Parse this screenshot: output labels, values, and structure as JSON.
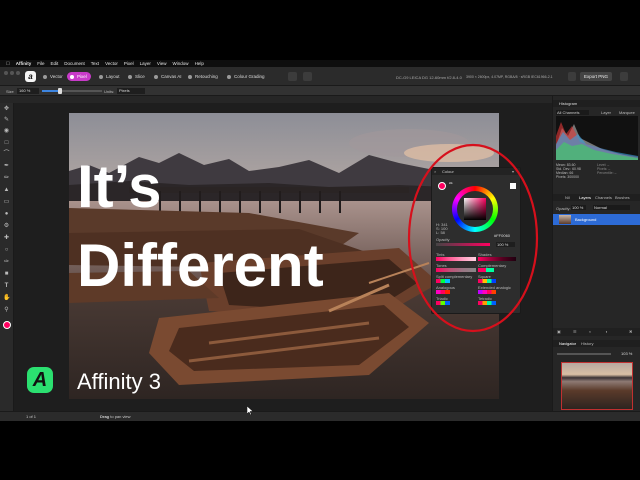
{
  "menubar": {
    "apple": "",
    "items": [
      "Affinity",
      "File",
      "Edit",
      "Document",
      "Text",
      "Vector",
      "Pixel",
      "Layer",
      "View",
      "Window",
      "Help"
    ]
  },
  "toolbar": {
    "personas": [
      {
        "label": "Vector",
        "active": false
      },
      {
        "label": "Pixel",
        "active": true
      },
      {
        "label": "Layout",
        "active": false
      },
      {
        "label": "Slice",
        "active": false
      },
      {
        "label": "Canvas AI",
        "active": false
      },
      {
        "label": "Retouching",
        "active": false
      },
      {
        "label": "Colour Grading",
        "active": false
      }
    ],
    "metadata": "DC-G9 LEICA DG 12-60mm f/2.8-4.0",
    "image_info": "3900 × 2600px, 4.07MP, RGBA/8 · sRGB IEC61966-2.1",
    "export_label": "Export PNG"
  },
  "contextbar": {
    "size_label": "Size",
    "size_value": "160 %",
    "units_label": "Units:",
    "units_value": "Pixels",
    "slider_fraction": 0.3
  },
  "document": {
    "title": "Finished colour image.jpg @ 103%"
  },
  "overlay": {
    "headline_line1": "It’s",
    "headline_line2": "Different",
    "brand_name": "Affinity 3",
    "logo_text": "A"
  },
  "colour_panel": {
    "title": "Colour",
    "readout_h": "H: 341",
    "readout_s": "S: 100",
    "readout_l": "L: 58",
    "hex": "FF0060",
    "opacity_label": "Opacity",
    "opacity_value": "100 %",
    "sections": [
      "Tints",
      "Shades",
      "Tones",
      "Complementary",
      "Split complementary",
      "Square",
      "Analogous",
      "Extended analogic",
      "Triadic",
      "Tetradic"
    ]
  },
  "right_panel": {
    "histogram_title": "Histogram",
    "histogram_channel": "All Channels",
    "histogram_layer": "Layer",
    "histogram_marquee": "Marquee",
    "stats_mean": "Mean: 83.60",
    "stats_std": "Std. Dev.: 60.98",
    "stats_median": "Median: 66",
    "stats_pixels": "Pixels: 300000",
    "stats_level": "Level: –",
    "stats_pixels2": "Pixels: –",
    "stats_percentile": "Percentile: –",
    "tabs": [
      "Nil",
      "Layers",
      "Channels",
      "Brushes"
    ],
    "opacity_label": "Opacity:",
    "opacity_value": "100 %",
    "blend_mode": "Normal",
    "layer_name": "Background",
    "navigator_title": "Navigator",
    "history_tab": "History",
    "zoom_value": "103 %",
    "nav_caption": "Finished colour image.jpg @ 103%"
  },
  "statusbar": {
    "page": "1 of 1",
    "hint_bold": "Drag",
    "hint_text": "to pan view"
  },
  "colors": {
    "accent": "#c83bc9",
    "primary_colour": "#ff0060",
    "annotation_ring": "#d6101c"
  },
  "icons": [
    "apple-icon",
    "search-icon",
    "gear-icon",
    "hand-icon",
    "zoom-icon",
    "brush-icon",
    "eraser-icon",
    "crop-icon",
    "move-icon",
    "eyedropper-icon"
  ]
}
